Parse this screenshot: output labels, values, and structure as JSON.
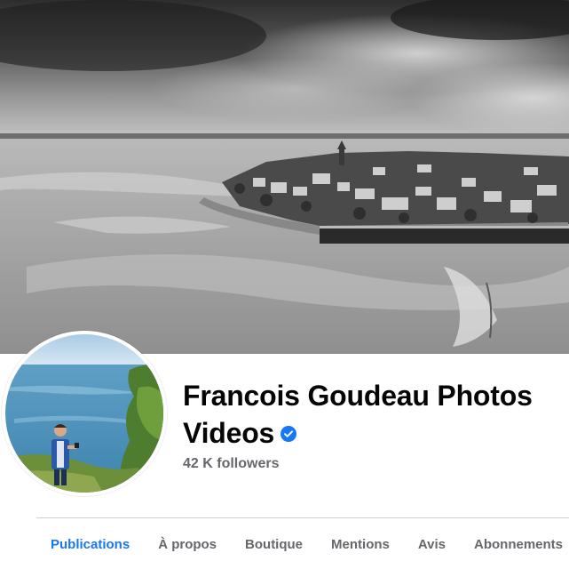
{
  "profile": {
    "name": "Francois Goudeau Photos Videos",
    "followers": "42 K followers",
    "verified": true
  },
  "tabs": [
    {
      "label": "Publications",
      "active": true
    },
    {
      "label": "À propos",
      "active": false
    },
    {
      "label": "Boutique",
      "active": false
    },
    {
      "label": "Mentions",
      "active": false
    },
    {
      "label": "Avis",
      "active": false
    },
    {
      "label": "Abonnements",
      "active": false
    }
  ],
  "colors": {
    "accent": "#1877f2",
    "text_primary": "#050505",
    "text_secondary": "#65676b",
    "divider": "#ced0d4"
  }
}
